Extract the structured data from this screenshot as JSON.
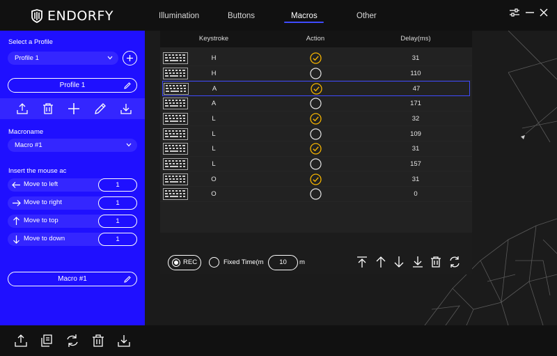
{
  "header": {
    "logo": "ENDORFY",
    "tabs": [
      {
        "label": "Illumination"
      },
      {
        "label": "Buttons"
      },
      {
        "label": "Macros"
      },
      {
        "label": "Other"
      }
    ],
    "active_tab": "Macros"
  },
  "sidebar": {
    "select_profile_label": "Select a Profile",
    "profile_dropdown": "Profile 1",
    "profile_name": "Profile 1",
    "macroname_label": "Macroname",
    "macro_dropdown": "Macro #1",
    "mouse_actions_label": "Insert the mouse ac",
    "mouse_actions": [
      {
        "label": "Move to left",
        "value": "1",
        "icon": "arrow-left-icon"
      },
      {
        "label": "Move to right",
        "value": "1",
        "icon": "arrow-right-icon"
      },
      {
        "label": "Move to top",
        "value": "1",
        "icon": "arrow-up-icon"
      },
      {
        "label": "Move to down",
        "value": "1",
        "icon": "arrow-down-icon"
      }
    ],
    "macro_name": "Macro #1"
  },
  "table": {
    "headers": {
      "keystroke": "Keystroke",
      "action": "Action",
      "delay": "Delay(ms)"
    },
    "rows": [
      {
        "key": "H",
        "checked": true,
        "delay": "31"
      },
      {
        "key": "H",
        "checked": false,
        "delay": "110"
      },
      {
        "key": "A",
        "checked": true,
        "delay": "47"
      },
      {
        "key": "A",
        "checked": false,
        "delay": "171"
      },
      {
        "key": "L",
        "checked": true,
        "delay": "32"
      },
      {
        "key": "L",
        "checked": false,
        "delay": "109"
      },
      {
        "key": "L",
        "checked": true,
        "delay": "31"
      },
      {
        "key": "L",
        "checked": false,
        "delay": "157"
      },
      {
        "key": "O",
        "checked": true,
        "delay": "31"
      },
      {
        "key": "O",
        "checked": false,
        "delay": "0"
      }
    ],
    "selected_row": 2
  },
  "controls": {
    "rec_label": "REC",
    "fixed_time_label": "Fixed Time(m",
    "fixed_time_value": "10",
    "unit": "m"
  },
  "colors": {
    "accent": "#1f10ff",
    "check": "#f5b400",
    "highlight": "#3f4bff"
  }
}
